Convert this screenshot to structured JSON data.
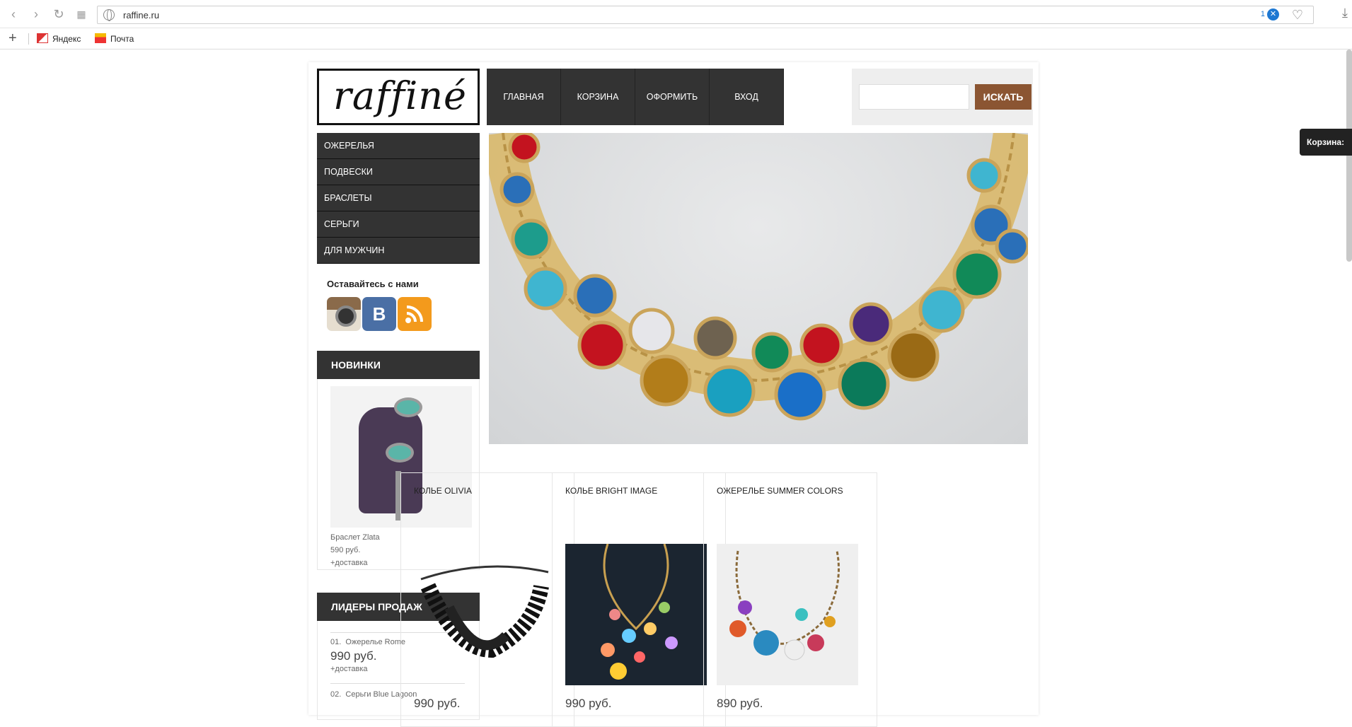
{
  "browser": {
    "url": "raffine.ru",
    "badge_count": "1",
    "bookmarks": [
      {
        "label": "Яндекс",
        "icon": "yandex-icon"
      },
      {
        "label": "Почта",
        "icon": "mail-icon"
      }
    ]
  },
  "site": {
    "logo_text": "raffiné",
    "nav": [
      "ГЛАВНАЯ",
      "КОРЗИНА",
      "ОФОРМИТЬ",
      "ВХОД"
    ],
    "search_button": "ИСКАТЬ",
    "search_value": "",
    "categories": [
      "ОЖЕРЕЛЬЯ",
      "ПОДВЕСКИ",
      "БРАСЛЕТЫ",
      "СЕРЬГИ",
      "ДЛЯ МУЖЧИН"
    ],
    "social_title": "Оставайтесь с нами",
    "new_title": "НОВИНКИ",
    "new_item": {
      "name": "Браслет Zlata",
      "price": "590 руб.",
      "delivery": "+доставка"
    },
    "leaders_title": "ЛИДЕРЫ ПРОДАЖ",
    "leaders": [
      {
        "num": "01.",
        "name": "Ожерелье Rome",
        "price": "990 руб.",
        "delivery": "+доставка"
      },
      {
        "num": "02.",
        "name": "Серьги Blue Lagoon"
      }
    ],
    "products": [
      {
        "name": "КОЛЬЕ OLIVIA",
        "price": "990 руб."
      },
      {
        "name": "КОЛЬЕ BRIGHT IMAGE",
        "price": "990 руб."
      },
      {
        "name": "ОЖЕРЕЛЬЕ SUMMER COLORS",
        "price": "890 руб."
      }
    ],
    "cart_tab": "Корзина:"
  }
}
